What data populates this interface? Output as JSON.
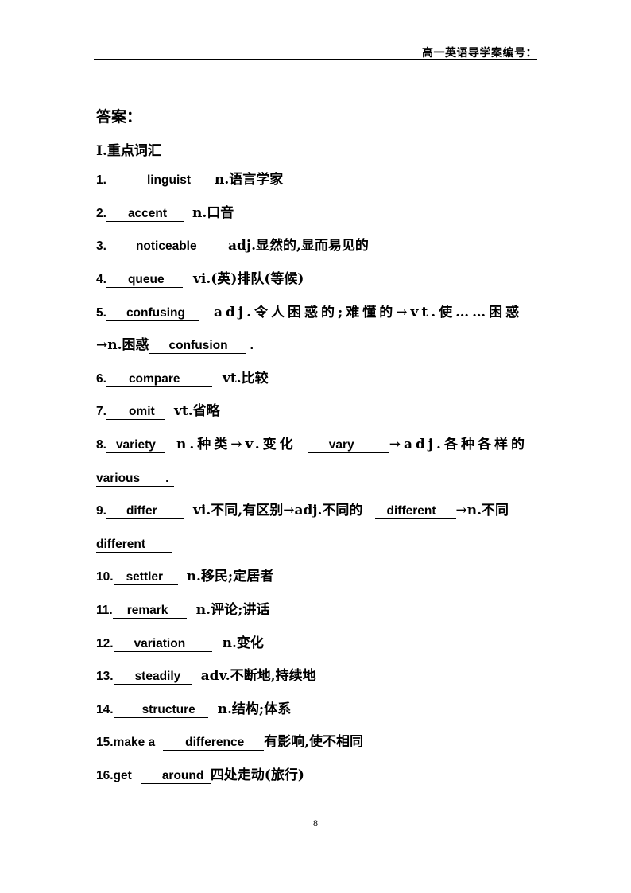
{
  "header": {
    "title": "高一英语导学案编号："
  },
  "answer_heading": "答案：",
  "section_title": "Ⅰ.重点词汇",
  "items": [
    {
      "num": "1.",
      "answer": "linguist",
      "def": "n.语言学家"
    },
    {
      "num": "2.",
      "answer": "accent",
      "def": "n.口音"
    },
    {
      "num": "3.",
      "answer": "noticeable",
      "def": "adj.显然的,显而易见的"
    },
    {
      "num": "4.",
      "answer": "queue",
      "def": "vi.(英)排队(等候)"
    },
    {
      "num": "5.",
      "answer": "confusing",
      "def": "adj.令人困惑的;难懂的→vt.使……困惑",
      "def2": "→n.困惑",
      "answer2": "confusion",
      "tail": "."
    },
    {
      "num": "6.",
      "answer": "compare",
      "def": "vt.比较"
    },
    {
      "num": "7.",
      "answer": "omit",
      "def": "vt.省略"
    },
    {
      "num": "8.",
      "answer": "variety",
      "def": "n.种类→v.变化",
      "answer2": "vary",
      "def2": "→adj.各种各样的",
      "answer3": "various",
      "tail": "."
    },
    {
      "num": "9.",
      "answer": "differ",
      "def": "vi.不同,有区别→adj.不同的",
      "answer2": "different",
      "def2": "→n.不同",
      "answer3": "different"
    },
    {
      "num": "10.",
      "answer": "settler",
      "def": "n.移民;定居者"
    },
    {
      "num": "11.",
      "answer": "remark",
      "def": "n.评论;讲话"
    },
    {
      "num": "12.",
      "answer": "variation",
      "def": "n.变化"
    },
    {
      "num": "13.",
      "answer": "steadily",
      "def": "adv.不断地,持续地"
    },
    {
      "num": "14.",
      "answer": "structure",
      "def": "n.结构;体系"
    },
    {
      "num": "15.make a",
      "answer": "difference",
      "def": "有影响,使不相同"
    },
    {
      "num": "16.get",
      "answer": "around",
      "def": "四处走动(旅行)"
    }
  ],
  "page_number": "8"
}
